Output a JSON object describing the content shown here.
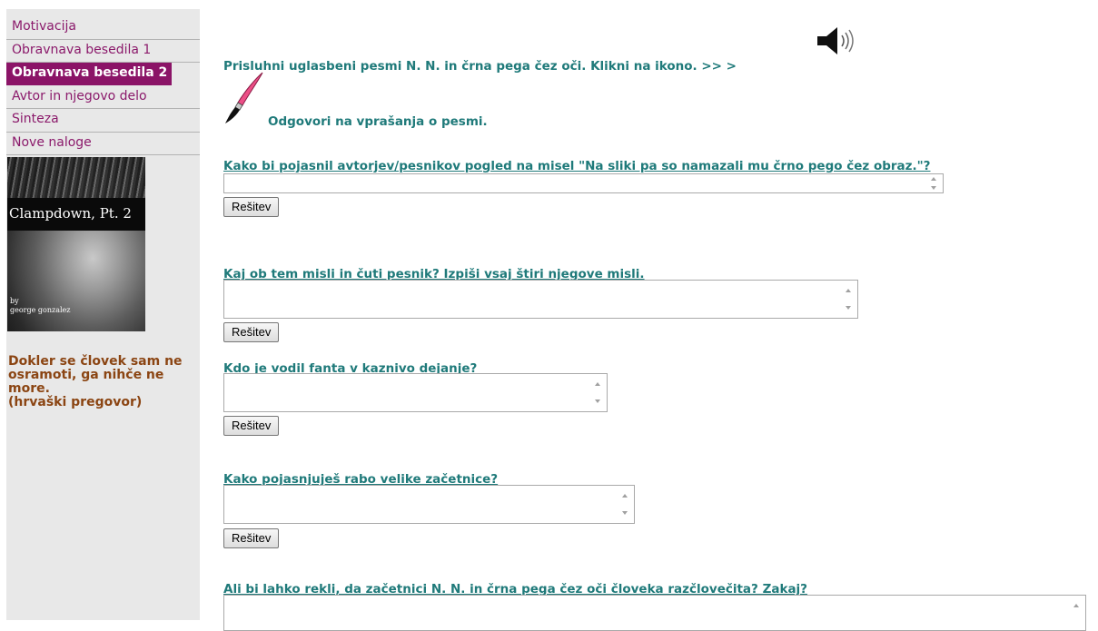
{
  "sidebar": {
    "items": [
      {
        "label": "Motivacija",
        "active": false
      },
      {
        "label": "Obravnava besedila 1",
        "active": false
      },
      {
        "label": "Obravnava besedila 2",
        "active": true
      },
      {
        "label": "Avtor in njegovo delo",
        "active": false
      },
      {
        "label": "Sinteza",
        "active": false
      },
      {
        "label": "Nove naloge",
        "active": false
      }
    ],
    "cover": {
      "title": "Clampdown, Pt. 2",
      "by": "by",
      "author": "george gonzalez"
    },
    "quote": {
      "line1": "Dokler se človek sam ne",
      "line2": "osramoti, ga nihče ne",
      "line3": "more.",
      "line4": "(hrvaški pregovor)"
    }
  },
  "main": {
    "listen_text": "Prisluhni uglasbeni pesmi N. N. in črna pega čez oči. Klikni na ikono. >> >",
    "answer_prompt": "Odgovori na vprašanja o pesmi.",
    "solution_label": "Rešitev",
    "questions": [
      {
        "text": "Kako bi pojasnil avtorjev/pesnikov pogled na misel \"Na sliki pa so namazali mu črno pego čez obraz.\"?"
      },
      {
        "text": "Kaj ob tem misli in čuti pesnik? Izpiši vsaj štiri njegove misli."
      },
      {
        "text": "Kdo je vodil fanta v kaznivo dejanje?"
      },
      {
        "text": "Kako pojasnjuješ rabo velike začetnice?"
      },
      {
        "text": "Ali bi lahko rekli, da začetnici N. N. in črna pega čez oči človeka razčlovečita? Zakaj?"
      }
    ]
  },
  "colors": {
    "menu_text": "#8b1a6b",
    "menu_active_bg": "#8b1467",
    "teal_text": "#1f7a7a",
    "quote_text": "#8b4513",
    "sidebar_bg": "#e8e8e8"
  },
  "icons": [
    "speaker-icon",
    "paintbrush-icon",
    "scroll-up-icon",
    "scroll-down-icon"
  ]
}
